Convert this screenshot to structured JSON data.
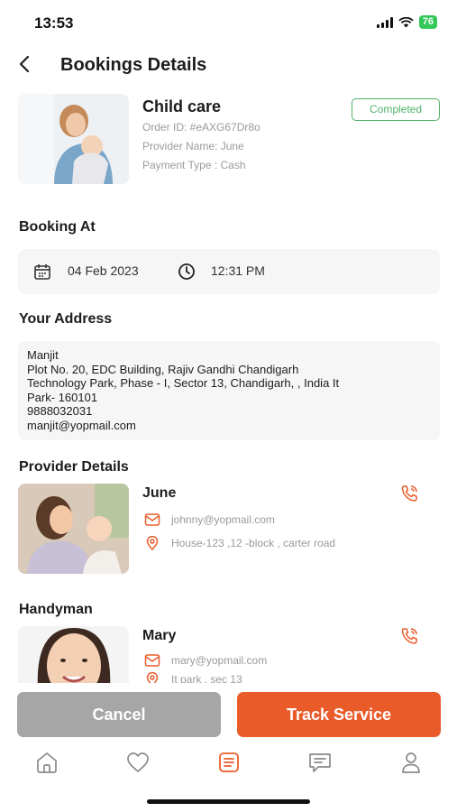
{
  "status": {
    "time": "13:53",
    "battery": "76"
  },
  "header": {
    "title": "Bookings Details"
  },
  "service": {
    "title": "Child care",
    "order_id": "Order ID: #eAXG67Dr8o",
    "provider_name": "Provider Name: June",
    "payment_type": "Payment Type : Cash",
    "status": "Completed"
  },
  "booking": {
    "title": "Booking At",
    "date": "04 Feb 2023",
    "time": "12:31 PM"
  },
  "address": {
    "title": "Your Address",
    "lines": [
      "Manjit",
      "Plot No. 20, EDC Building, Rajiv Gandhi Chandigarh",
      "Technology Park, Phase - I, Sector 13, Chandigarh, , India It",
      "Park- 160101",
      "9888032031",
      "manjit@yopmail.com"
    ]
  },
  "provider": {
    "title": "Provider Details",
    "name": "June",
    "email": "johnny@yopmail.com",
    "location": "House-123 ,12 -block , carter road"
  },
  "handyman": {
    "title": "Handyman",
    "name": "Mary",
    "email": "mary@yopmail.com",
    "location": "It park , sec 13"
  },
  "actions": {
    "cancel": "Cancel",
    "track": "Track Service"
  },
  "colors": {
    "accent": "#ea5b2a",
    "success": "#4fb26a",
    "muted": "#a6a6a6"
  },
  "tabs": [
    "home-icon",
    "heart-icon",
    "bookings-icon",
    "chat-icon",
    "profile-icon"
  ]
}
